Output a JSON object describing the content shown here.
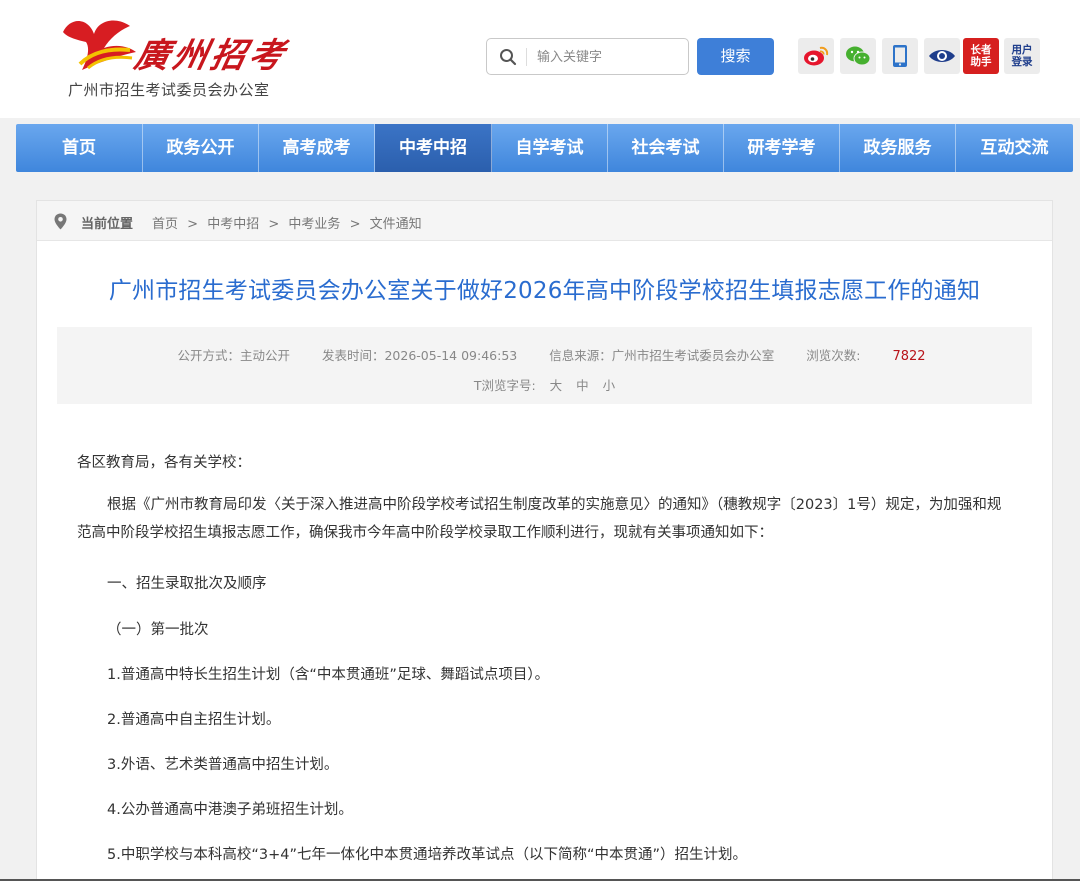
{
  "header": {
    "logo_script": "廣州招考",
    "logo_sub": "广州市招生考试委员会办公室",
    "search": {
      "placeholder": "输入关键字",
      "button": "搜索"
    },
    "util": {
      "elder_helper": "长者助手",
      "user_login": "用户登录"
    }
  },
  "nav": {
    "items": [
      {
        "label": "首页"
      },
      {
        "label": "政务公开"
      },
      {
        "label": "高考成考"
      },
      {
        "label": "中考中招"
      },
      {
        "label": "自学考试"
      },
      {
        "label": "社会考试"
      },
      {
        "label": "研考学考"
      },
      {
        "label": "政务服务"
      },
      {
        "label": "互动交流"
      }
    ],
    "active_index": 3
  },
  "breadcrumb": {
    "label": "当前位置",
    "items": [
      "首页",
      "中考中招",
      "中考业务",
      "文件通知"
    ],
    "separator": ">"
  },
  "article": {
    "title": "广州市招生考试委员会办公室关于做好2026年高中阶段学校招生填报志愿工作的通知",
    "meta": {
      "mode": "公开方式：主动公开",
      "time": "发表时间：2026-05-14 09:46:53",
      "source": "信息来源：广州市招生考试委员会办公室",
      "views_label": "浏览次数:",
      "views": "7822",
      "font_label": "T浏览字号:",
      "font_large": "大",
      "font_medium": "中",
      "font_small": "小"
    },
    "body": {
      "salutation": "各区教育局，各有关学校：",
      "intro": "根据《广州市教育局印发〈关于深入推进高中阶段学校考试招生制度改革的实施意见〉的通知》（穗教规字〔2023〕1号）规定，为加强和规范高中阶段学校招生填报志愿工作，确保我市今年高中阶段学校录取工作顺利进行，现就有关事项通知如下：",
      "section1": "一、招生录取批次及顺序",
      "sub1": "（一）第一批次",
      "items": [
        "1.普通高中特长生招生计划（含“中本贯通班”足球、舞蹈试点项目）。",
        "2.普通高中自主招生计划。",
        "3.外语、艺术类普通高中招生计划。",
        "4.公办普通高中港澳子弟班招生计划。",
        "5.中职学校与本科高校“3+4”七年一体化中本贯通培养改革试点（以下简称“中本贯通”）招生计划。"
      ]
    }
  },
  "colors": {
    "nav_blue": "#4a8de0",
    "nav_active": "#2f64b3",
    "title_blue": "#2a6ccf",
    "views_red": "#b8141a",
    "brand_red": "#c8161d"
  }
}
